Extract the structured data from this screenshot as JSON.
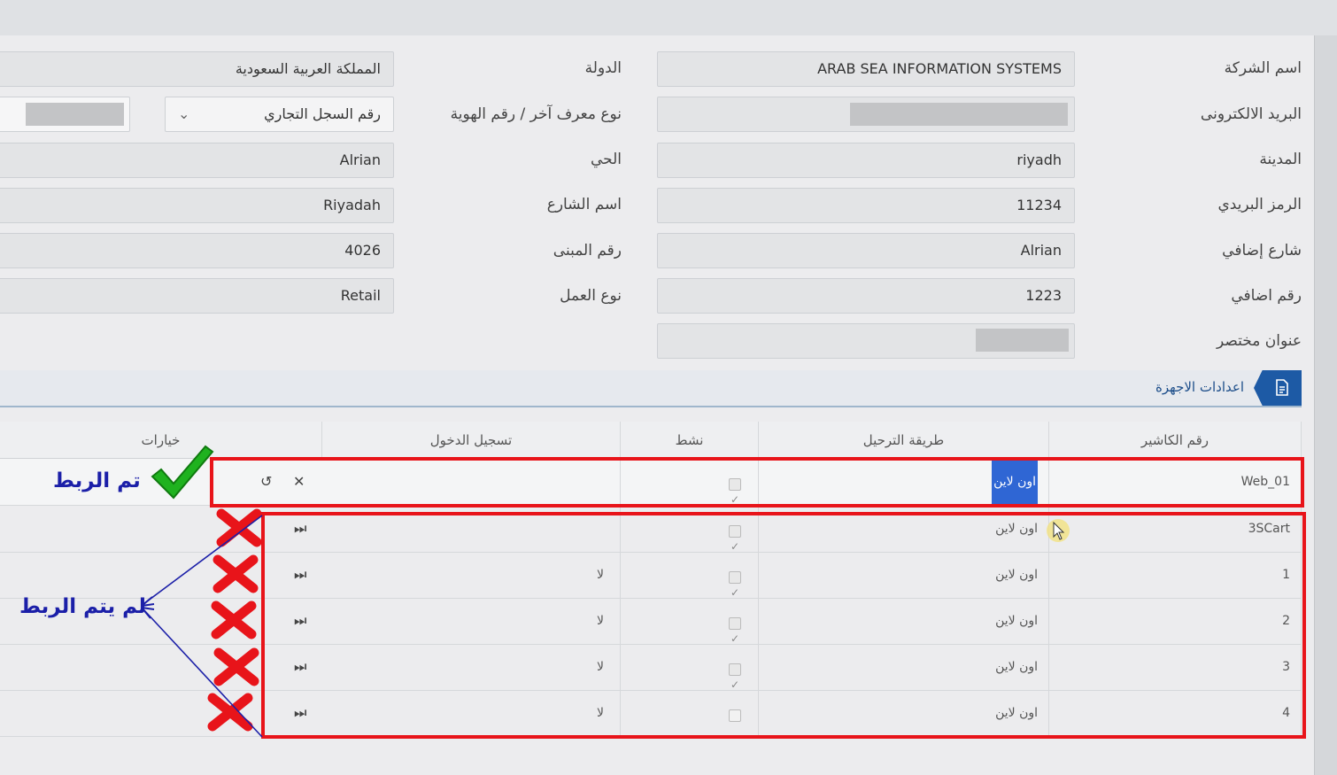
{
  "form": {
    "company_name": {
      "label": "اسم الشركة",
      "value": "ARAB SEA INFORMATION  SYSTEMS"
    },
    "country": {
      "label": "الدولة",
      "value": "المملكة العربية السعودية"
    },
    "email": {
      "label": "البريد الالكترونى",
      "value": ""
    },
    "id_type": {
      "label": "نوع معرف آخر / رقم الهوية",
      "value": "رقم السجل التجاري"
    },
    "city": {
      "label": "المدينة",
      "value": "riyadh"
    },
    "district": {
      "label": "الحي",
      "value": "Alrian"
    },
    "postal_code": {
      "label": "الرمز البريدي",
      "value": "11234"
    },
    "street_name": {
      "label": "اسم الشارع",
      "value": "Riyadah"
    },
    "additional_street": {
      "label": "شارع إضافي",
      "value": "Alrian"
    },
    "building_number": {
      "label": "رقم المبنى",
      "value": "4026"
    },
    "additional_number": {
      "label": "رقم اضافي",
      "value": "1223"
    },
    "business_type": {
      "label": "نوع العمل",
      "value": "Retail"
    },
    "short_address": {
      "label": "عنوان مختصر",
      "value": ""
    }
  },
  "section": {
    "title": "اعدادات الاجهزة",
    "icon": "document-icon"
  },
  "table": {
    "headers": {
      "cashier": "رقم الكاشير",
      "method": "طريقة الترحيل",
      "active": "نشط",
      "login": "تسجيل الدخول",
      "options": "خيارات"
    },
    "rows": [
      {
        "cashier": "Web_01",
        "method": "اون لاين",
        "active": true,
        "login": "",
        "highlighted": true
      },
      {
        "cashier": "3SCart",
        "method": "اون لاين",
        "active": true,
        "login": ""
      },
      {
        "cashier": "1",
        "method": "اون لاين",
        "active": true,
        "login": "لا"
      },
      {
        "cashier": "2",
        "method": "اون لاين",
        "active": true,
        "login": "لا"
      },
      {
        "cashier": "3",
        "method": "اون لاين",
        "active": true,
        "login": "لا"
      },
      {
        "cashier": "4",
        "method": "اون لاين",
        "active": false,
        "login": "لا"
      }
    ]
  },
  "annotations": {
    "linked": "تم الربط",
    "not_linked": "لم يتم الربط",
    "colors": {
      "box": "#e8141a",
      "text": "#1b1fa8",
      "check": "#1fb21f",
      "cross": "#e8141a"
    }
  }
}
